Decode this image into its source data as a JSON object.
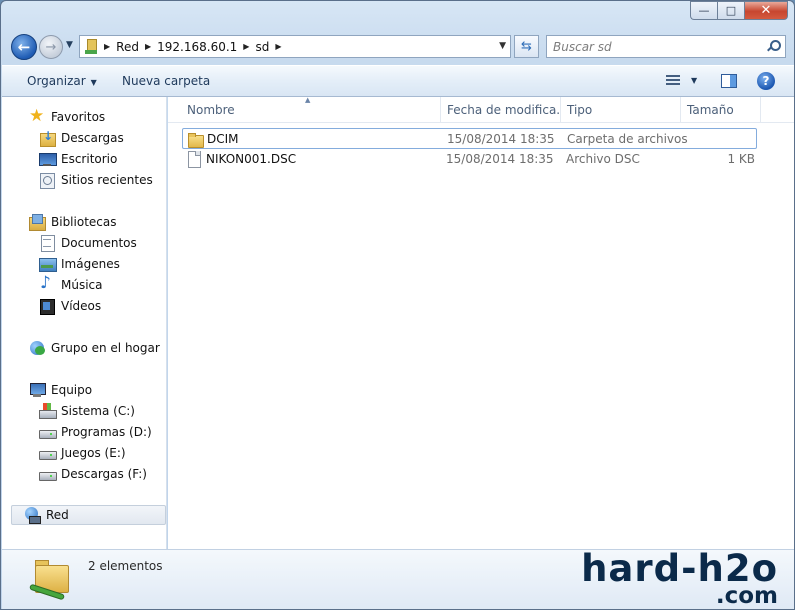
{
  "caption_buttons": {
    "minimize": "—",
    "maximize": "□",
    "close": "✕"
  },
  "address": {
    "crumbs": [
      "Red",
      "192.168.60.1",
      "sd"
    ]
  },
  "search": {
    "placeholder": "Buscar sd"
  },
  "toolbar": {
    "organize": "Organizar",
    "new_folder": "Nueva carpeta",
    "help": "?"
  },
  "sidebar": {
    "favorites": {
      "label": "Favoritos",
      "items": [
        "Descargas",
        "Escritorio",
        "Sitios recientes"
      ]
    },
    "libraries": {
      "label": "Bibliotecas",
      "items": [
        "Documentos",
        "Imágenes",
        "Música",
        "Vídeos"
      ]
    },
    "homegroup": {
      "label": "Grupo en el hogar"
    },
    "computer": {
      "label": "Equipo",
      "items": [
        "Sistema (C:)",
        "Programas (D:)",
        "Juegos (E:)",
        "Descargas (F:)"
      ]
    },
    "network": {
      "label": "Red"
    }
  },
  "columns": [
    "Nombre",
    "Fecha de modifica...",
    "Tipo",
    "Tamaño"
  ],
  "files": [
    {
      "name": "DCIM",
      "date": "15/08/2014 18:35",
      "type": "Carpeta de archivos",
      "size": "",
      "icon": "folder-icon"
    },
    {
      "name": "NIKON001.DSC",
      "date": "15/08/2014 18:35",
      "type": "Archivo DSC",
      "size": "1 KB",
      "icon": "file-icon"
    }
  ],
  "details": {
    "count": "2 elementos"
  },
  "watermark": {
    "line1": "hard-h2o",
    "line2": ".com"
  }
}
